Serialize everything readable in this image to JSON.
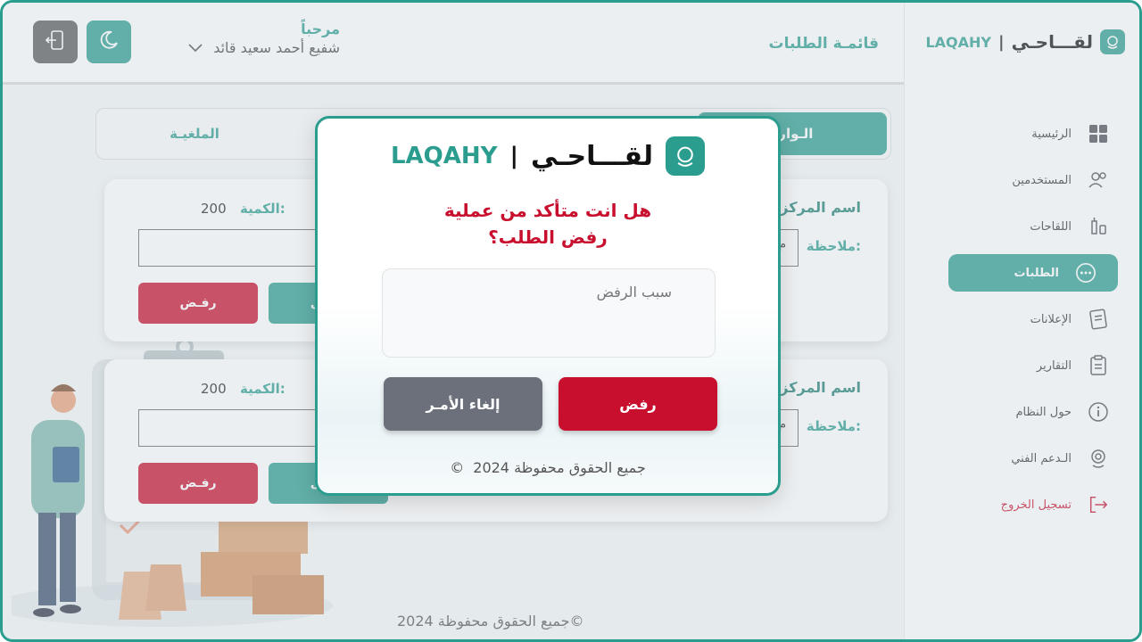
{
  "brand": {
    "arabic": "لقـــاحـي",
    "separator": "|",
    "latin": "LAQAHY"
  },
  "sidebar": {
    "items": [
      {
        "label": "الرئيسية",
        "icon": "dashboard-icon"
      },
      {
        "label": "المستخدمين",
        "icon": "users-icon"
      },
      {
        "label": "اللقاحات",
        "icon": "vaccine-icon"
      },
      {
        "label": "الطلبات",
        "icon": "chat-bubble-icon",
        "active": true
      },
      {
        "label": "الإعلانات",
        "icon": "document-icon"
      },
      {
        "label": "التقارير",
        "icon": "clipboard-icon"
      },
      {
        "label": "حول النظام",
        "icon": "info-icon"
      },
      {
        "label": "الـدعم الفني",
        "icon": "support-icon"
      },
      {
        "label": "تسجيل الخروج",
        "icon": "logout-icon"
      }
    ]
  },
  "header": {
    "page_title": "قائمـة الطلبات",
    "welcome": "مرحباً",
    "user_name": "شفيع أحمد سعيد قائد"
  },
  "tabs": {
    "incoming": "الـوارد",
    "cancelled": "الملغيـة"
  },
  "cards": [
    {
      "center_label": "اسم المركز",
      "quantity_label": "الكمية:",
      "quantity": "200",
      "note_label": "ملاحظة:",
      "note_value": "م",
      "reject": "رفـض",
      "accept": "قبـول"
    },
    {
      "center_label": "اسم المركز",
      "quantity_label": "الكمية:",
      "quantity": "200",
      "note_label": "ملاحظة:",
      "note_value": "م",
      "reject": "رفـض",
      "accept": "قبـول"
    }
  ],
  "footer": {
    "copyright": "جميع الحقوق محفوظة 2024",
    "symbol": "©"
  },
  "modal": {
    "question_line1": "هل انت متأكد من عملية",
    "question_line2": "رفض الطلب؟",
    "reason_placeholder": "سبب الرفض",
    "confirm_reject": "رفض",
    "cancel": "إلغاء الأمـر",
    "copyright": "جميع الحقوق محفوظة 2024",
    "symbol": "©"
  },
  "colors": {
    "primary": "#2a9d8f",
    "danger": "#c8102e",
    "neutral": "#6c707a"
  }
}
